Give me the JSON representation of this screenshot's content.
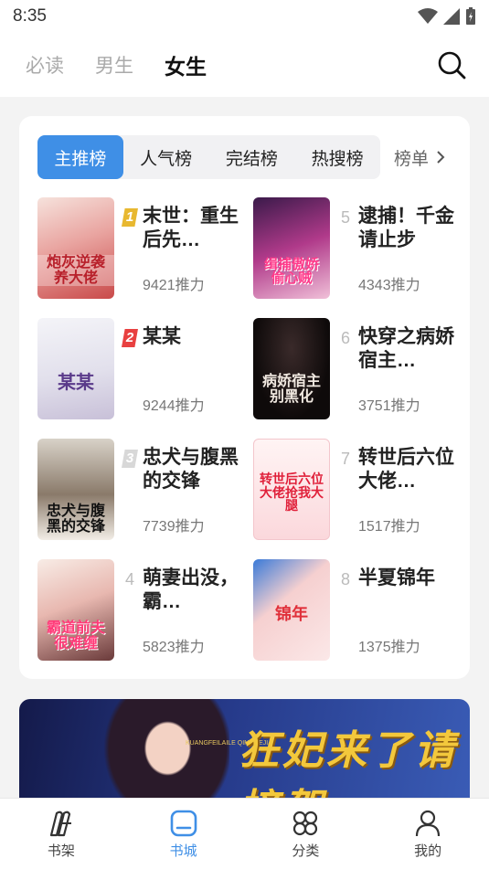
{
  "status_bar": {
    "time": "8:35"
  },
  "top_tabs": [
    {
      "label": "必读",
      "active": false
    },
    {
      "label": "男生",
      "active": false
    },
    {
      "label": "女生",
      "active": true
    }
  ],
  "rank_tabs": [
    {
      "label": "主推榜",
      "active": true
    },
    {
      "label": "人气榜",
      "active": false
    },
    {
      "label": "完结榜",
      "active": false
    },
    {
      "label": "热搜榜",
      "active": false
    }
  ],
  "rank_more_label": "榜单",
  "books": [
    {
      "rank": "1",
      "title": "末世：重生后先…",
      "heat": "9421推力",
      "cover_text": "炮灰逆袭养大佬",
      "cover_color": "#c94a4a"
    },
    {
      "rank": "5",
      "title": "逮捕！千金请止步",
      "heat": "4343推力",
      "cover_text": "缉捕傲娇偷心贼",
      "cover_color": "#b03a8a"
    },
    {
      "rank": "2",
      "title": "某某",
      "heat": "9244推力",
      "cover_text": "某某",
      "cover_color": "#6a5a9a"
    },
    {
      "rank": "6",
      "title": "快穿之病娇宿主…",
      "heat": "3751推力",
      "cover_text": "病娇宿主别黑化",
      "cover_color": "#e8e0d8"
    },
    {
      "rank": "3",
      "title": "忠犬与腹黑的交锋",
      "heat": "7739推力",
      "cover_text": "忠犬与腹黑的交锋",
      "cover_color": "#222222"
    },
    {
      "rank": "7",
      "title": "转世后六位大佬…",
      "heat": "1517推力",
      "cover_text": "转世后六位大佬抢我大腿",
      "cover_color": "#e04060"
    },
    {
      "rank": "4",
      "title": "萌妻出没，霸…",
      "heat": "5823推力",
      "cover_text": "霸道前夫很难缠",
      "cover_color": "#d83a6a"
    },
    {
      "rank": "8",
      "title": "半夏锦年",
      "heat": "1375推力",
      "cover_text": "锦年",
      "cover_color": "#e0505a"
    }
  ],
  "banner": {
    "title": "狂妃来了请接驾",
    "subtitle": "KUANGFEILAILE QINGJIEJIA"
  },
  "bottom_nav": [
    {
      "label": "书架",
      "icon": "bookshelf-icon",
      "active": false
    },
    {
      "label": "书城",
      "icon": "bookstore-icon",
      "active": true
    },
    {
      "label": "分类",
      "icon": "category-icon",
      "active": false
    },
    {
      "label": "我的",
      "icon": "profile-icon",
      "active": false
    }
  ],
  "colors": {
    "accent": "#3f8fe6",
    "rank_badge_1": "#e8b830",
    "rank_badge_2": "#e84040",
    "rank_badge_3": "#cccccc"
  }
}
